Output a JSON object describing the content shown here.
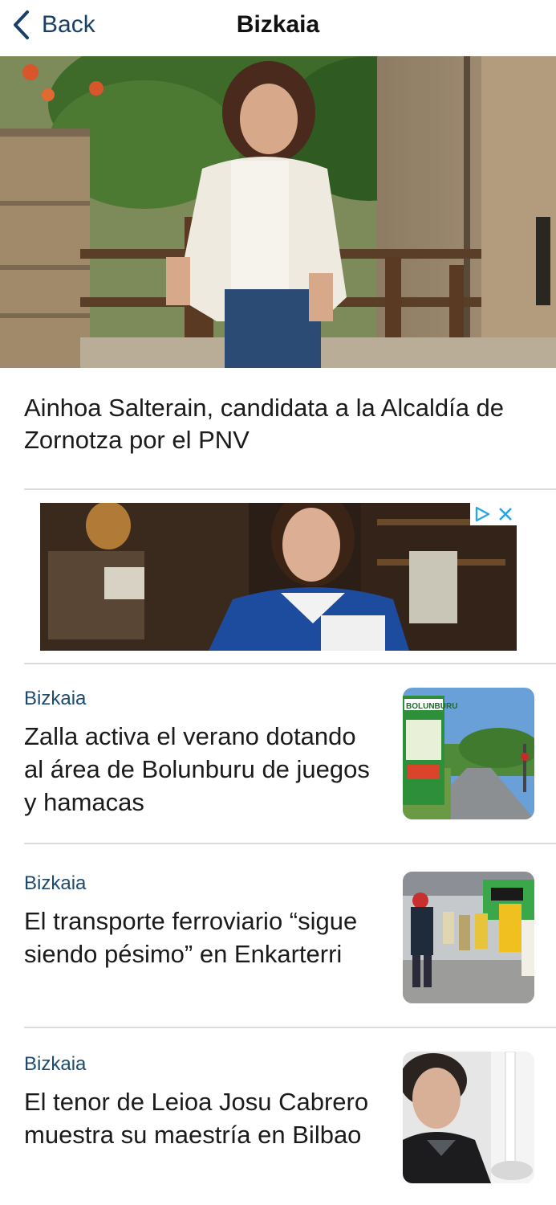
{
  "nav": {
    "back_label": "Back",
    "title": "Bizkaia"
  },
  "hero": {
    "headline": "Ainhoa Salterain, candidata a la Alcaldía de Zornotza por el PNV"
  },
  "ad": {
    "badge_icons": [
      "adchoices-icon",
      "close-icon"
    ]
  },
  "articles": [
    {
      "category": "Bizkaia",
      "title": "Zalla activa el verano dotando al área de Bolunburu de juegos y hamacas",
      "thumb_sign_text": "BOLUNBURU"
    },
    {
      "category": "Bizkaia",
      "title": "El transporte ferroviario “sigue siendo pésimo” en Enkarterri"
    },
    {
      "category": "Bizkaia",
      "title": "El tenor de Leioa Josu Cabrero muestra su maestría en Bilbao"
    }
  ],
  "colors": {
    "accent": "#1a3f66",
    "category": "#1c4a70",
    "divider": "#dcdcdc",
    "ad_badge": "#28a8e0"
  }
}
